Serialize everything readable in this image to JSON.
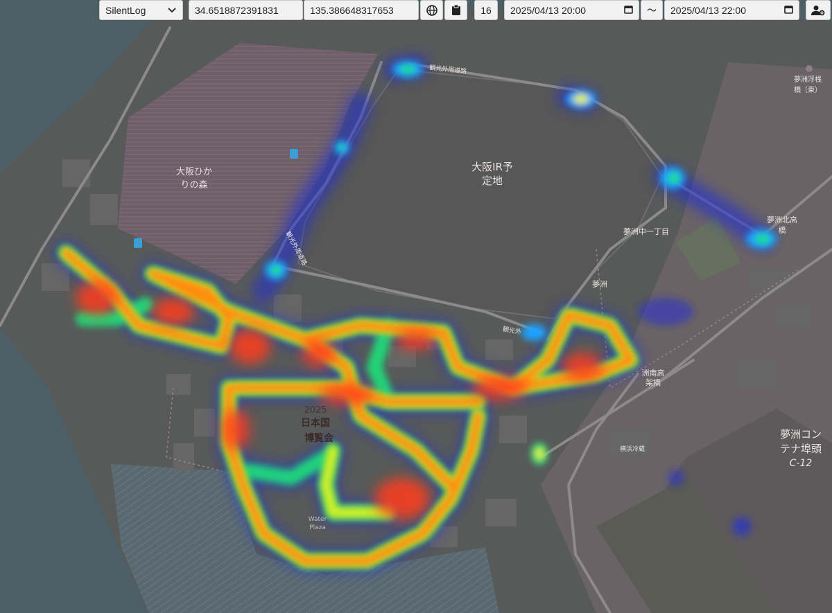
{
  "toolbar": {
    "source_select": "SilentLog",
    "latitude": "34.6518872391831",
    "longitude": "135.386648317653",
    "zoom": "16",
    "start_datetime": "2025/04/13 20:00",
    "range_separator": "〜",
    "end_datetime": "2025/04/13 22:00",
    "icons": [
      "globe-icon",
      "clipboard-icon",
      "calendar-icon",
      "user-settings-icon",
      "chevron-down-icon"
    ]
  },
  "map": {
    "labels": {
      "ir_site_l1": "大阪IR予",
      "ir_site_l2": "定地",
      "hikari_l1": "大阪ひか",
      "hikari_l2": "りの森",
      "expo_l1": "日本国",
      "expo_l2": "博覧会",
      "expo_year": "2025",
      "container_l1": "夢洲コン",
      "container_l2": "テナ埠頭",
      "container_l3": "C-12",
      "yumeshima": "夢洲",
      "chome": "夢洲中一丁目",
      "north_bridge_l1": "夢洲北高",
      "north_bridge_l2": "橋",
      "south_bridge_l1": "洲南高",
      "south_bridge_l2": "架橋",
      "ferry_bridge_l1": "夢洲浮桟",
      "ferry_bridge_l2": "橋（東）",
      "outer_road_top": "観光外周道路",
      "outer_road_left": "観光外周道路",
      "outer_road_bottom": "観光外",
      "water_plaza_l1": "Water",
      "water_plaza_l2": "Plaza",
      "yokohama": "横浜冷蔵"
    },
    "heat_colors": [
      "#1f2bd9",
      "#1ea2ff",
      "#1fe07a",
      "#e6f21a",
      "#ff8c0a",
      "#ff3d1a"
    ]
  }
}
